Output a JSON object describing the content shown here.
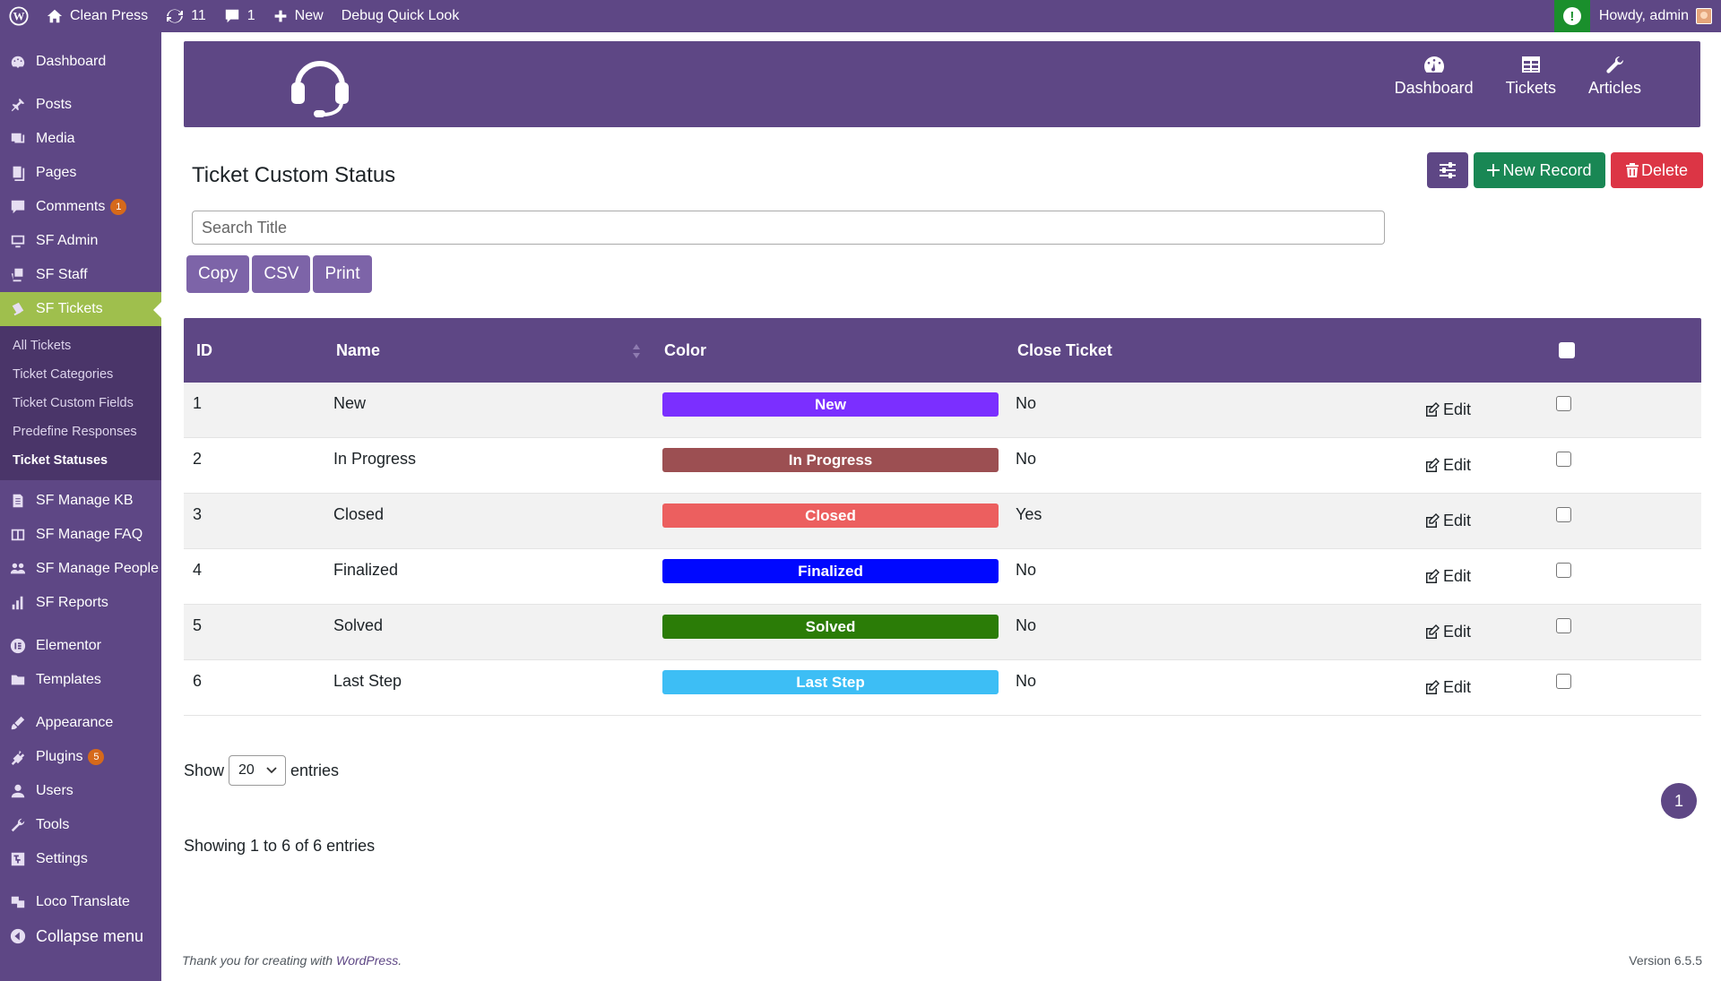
{
  "adminbar": {
    "site_name": "Clean Press",
    "updates_count": "11",
    "comments_count": "1",
    "new_label": "New",
    "debug_label": "Debug Quick Look",
    "howdy": "Howdy, admin",
    "health_glyph": "!"
  },
  "sidebar": {
    "dashboard": "Dashboard",
    "posts": "Posts",
    "media": "Media",
    "pages": "Pages",
    "comments": "Comments",
    "comments_badge": "1",
    "sf_admin": "SF Admin",
    "sf_staff": "SF Staff",
    "sf_tickets": "SF Tickets",
    "submenu": [
      "All Tickets",
      "Ticket Categories",
      "Ticket Custom Fields",
      "Predefine Responses",
      "Ticket Statuses"
    ],
    "sf_manage_kb": "SF Manage KB",
    "sf_manage_faq": "SF Manage FAQ",
    "sf_manage_people": "SF Manage People",
    "sf_reports": "SF Reports",
    "elementor": "Elementor",
    "templates": "Templates",
    "appearance": "Appearance",
    "plugins": "Plugins",
    "plugins_badge": "5",
    "users": "Users",
    "tools": "Tools",
    "settings": "Settings",
    "loco": "Loco Translate",
    "collapse": "Collapse menu"
  },
  "topnav": {
    "dashboard": "Dashboard",
    "tickets": "Tickets",
    "articles": "Articles"
  },
  "page": {
    "title": "Ticket Custom Status",
    "new_record": "New Record",
    "delete": "Delete",
    "search_placeholder": "Search Title"
  },
  "export": {
    "copy": "Copy",
    "csv": "CSV",
    "print": "Print"
  },
  "table": {
    "headers": {
      "id": "ID",
      "name": "Name",
      "color": "Color",
      "close_ticket": "Close Ticket"
    },
    "edit_label": "Edit",
    "rows": [
      {
        "id": "1",
        "name": "New",
        "status": "New",
        "color": "#7b2fff",
        "close": "No"
      },
      {
        "id": "2",
        "name": "In Progress",
        "status": "In Progress",
        "color": "#9c4f52",
        "close": "No"
      },
      {
        "id": "3",
        "name": "Closed",
        "status": "Closed",
        "color": "#ec5f5f",
        "close": "Yes"
      },
      {
        "id": "4",
        "name": "Finalized",
        "status": "Finalized",
        "color": "#0008ff",
        "close": "No"
      },
      {
        "id": "5",
        "name": "Solved",
        "status": "Solved",
        "color": "#2b7c07",
        "close": "No"
      },
      {
        "id": "6",
        "name": "Last Step",
        "status": "Last Step",
        "color": "#3dbef5",
        "close": "No"
      }
    ]
  },
  "pagination": {
    "show": "Show",
    "entries_value": "20",
    "entries": "entries",
    "current_page": "1",
    "info": "Showing 1 to 6 of 6 entries"
  },
  "footer": {
    "thanks_prefix": "Thank you for creating with ",
    "wordpress": "WordPress",
    "thanks_suffix": ".",
    "version": "Version 6.5.5"
  },
  "colors": {
    "brand": "#5e4785",
    "active": "#9fbf4d",
    "success": "#198754",
    "danger": "#dc3545"
  }
}
